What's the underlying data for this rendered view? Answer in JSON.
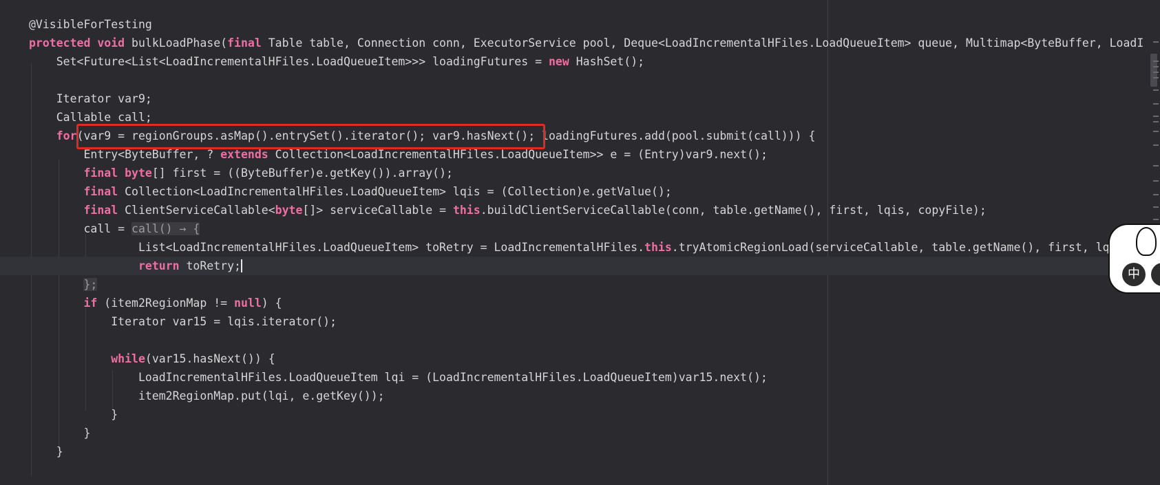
{
  "editor": {
    "lines": [
      [
        {
          "t": "@VisibleForTesting"
        }
      ],
      [
        {
          "t": "protected",
          "c": "kw"
        },
        {
          "t": " "
        },
        {
          "t": "void",
          "c": "kw"
        },
        {
          "t": " bulkLoadPhase("
        },
        {
          "t": "final",
          "c": "kw"
        },
        {
          "t": " Table table, Connection conn, ExecutorService pool, Deque<LoadIncrementalHFiles.LoadQueueItem> queue, Multimap<ByteBuffer, LoadI"
        }
      ],
      [
        {
          "t": "    Set<Future<List<LoadIncrementalHFiles.LoadQueueItem>>> loadingFutures = "
        },
        {
          "t": "new",
          "c": "kw"
        },
        {
          "t": " HashSet();"
        }
      ],
      [
        {
          "t": ""
        }
      ],
      [
        {
          "t": "    Iterator var9;"
        }
      ],
      [
        {
          "t": "    Callable call;"
        }
      ],
      [
        {
          "t": "    "
        },
        {
          "t": "for",
          "c": "kw"
        },
        {
          "t": "(var9 = regionGroups.asMap().entrySet().iterator(); var9.hasNext(); loadingFutures.add(pool.submit(call))) {"
        }
      ],
      [
        {
          "t": "        Entry<ByteBuffer, ? "
        },
        {
          "t": "extends",
          "c": "kw"
        },
        {
          "t": " Collection<LoadIncrementalHFiles.LoadQueueItem>> e = (Entry)var9.next();"
        }
      ],
      [
        {
          "t": "        "
        },
        {
          "t": "final",
          "c": "kw"
        },
        {
          "t": " "
        },
        {
          "t": "byte",
          "c": "kw"
        },
        {
          "t": "[] first = ((ByteBuffer)e.getKey()).array();"
        }
      ],
      [
        {
          "t": "        "
        },
        {
          "t": "final",
          "c": "kw"
        },
        {
          "t": " Collection<LoadIncrementalHFiles.LoadQueueItem> lqis = (Collection)e.getValue();"
        }
      ],
      [
        {
          "t": "        "
        },
        {
          "t": "final",
          "c": "kw"
        },
        {
          "t": " ClientServiceCallable<"
        },
        {
          "t": "byte",
          "c": "kw"
        },
        {
          "t": "[]> serviceCallable = "
        },
        {
          "t": "this",
          "c": "kw"
        },
        {
          "t": ".buildClientServiceCallable(conn, table.getName(), first, lqis, copyFile);"
        }
      ],
      [
        {
          "t": "        call = "
        },
        {
          "t": "call() → {",
          "c": "fold"
        }
      ],
      [
        {
          "t": "                List<LoadIncrementalHFiles.LoadQueueItem> toRetry = LoadIncrementalHFiles."
        },
        {
          "t": "this",
          "c": "kw"
        },
        {
          "t": ".tryAtomicRegionLoad(serviceCallable, table.getName(), first, lqis)"
        }
      ],
      [
        {
          "t": "                "
        },
        {
          "t": "return",
          "c": "kw"
        },
        {
          "t": " toRetry;"
        },
        {
          "t": "",
          "c": "caret"
        }
      ],
      [
        {
          "t": "        "
        },
        {
          "t": "};",
          "c": "fold"
        }
      ],
      [
        {
          "t": "        "
        },
        {
          "t": "if",
          "c": "kw"
        },
        {
          "t": " (item2RegionMap != "
        },
        {
          "t": "null",
          "c": "kw"
        },
        {
          "t": ") {"
        }
      ],
      [
        {
          "t": "            Iterator var15 = lqis.iterator();"
        }
      ],
      [
        {
          "t": ""
        }
      ],
      [
        {
          "t": "            "
        },
        {
          "t": "while",
          "c": "kw"
        },
        {
          "t": "(var15.hasNext()) {"
        }
      ],
      [
        {
          "t": "                LoadIncrementalHFiles.LoadQueueItem lqi = (LoadIncrementalHFiles.LoadQueueItem)var15.next();"
        }
      ],
      [
        {
          "t": "                item2RegionMap.put(lqi, e.getKey());"
        }
      ],
      [
        {
          "t": "            }"
        }
      ],
      [
        {
          "t": "        }"
        }
      ],
      [
        {
          "t": "    }"
        }
      ]
    ],
    "current_line_index": 13,
    "highlighted_text": "(var9 = regionGroups.asMap().entrySet().iterator(); var9.hasNext();"
  },
  "ime": {
    "primary_label": "中"
  },
  "colors": {
    "background": "#2b2b2f",
    "keyword": "#ef6ea3",
    "text": "#d6d6d6",
    "highlight_box": "#e02a24"
  }
}
